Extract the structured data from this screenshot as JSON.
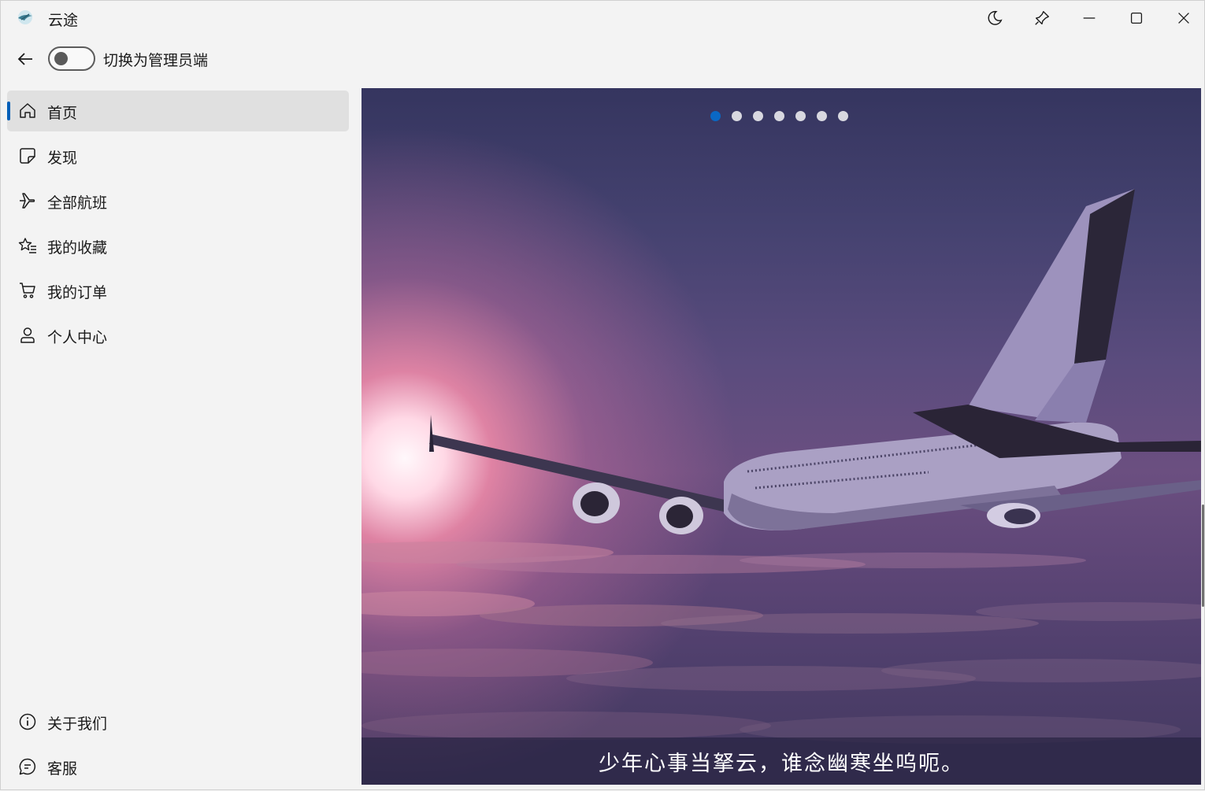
{
  "window": {
    "title": "云途",
    "buttons": [
      "theme-toggle",
      "pin",
      "minimize",
      "maximize",
      "close"
    ]
  },
  "header": {
    "back_icon": "arrow-left-icon",
    "toggle_label": "切换为管理员端",
    "toggle_on": false
  },
  "sidebar": {
    "items": [
      {
        "label": "首页",
        "icon": "home-icon",
        "active": true
      },
      {
        "label": "发现",
        "icon": "note-icon",
        "active": false
      },
      {
        "label": "全部航班",
        "icon": "airplane-icon",
        "active": false
      },
      {
        "label": "我的收藏",
        "icon": "star-list-icon",
        "active": false
      },
      {
        "label": "我的订单",
        "icon": "cart-icon",
        "active": false
      },
      {
        "label": "个人中心",
        "icon": "person-icon",
        "active": false
      }
    ],
    "footer": [
      {
        "label": "关于我们",
        "icon": "info-icon"
      },
      {
        "label": "客服",
        "icon": "chat-icon"
      }
    ]
  },
  "carousel": {
    "slide_count": 7,
    "active_index": 0,
    "caption": "少年心事当拏云，谁念幽寒坐呜呃。"
  },
  "colors": {
    "accent": "#005fb8",
    "dot_active": "#0a68c4",
    "sidebar_bg": "#f3f3f3"
  }
}
